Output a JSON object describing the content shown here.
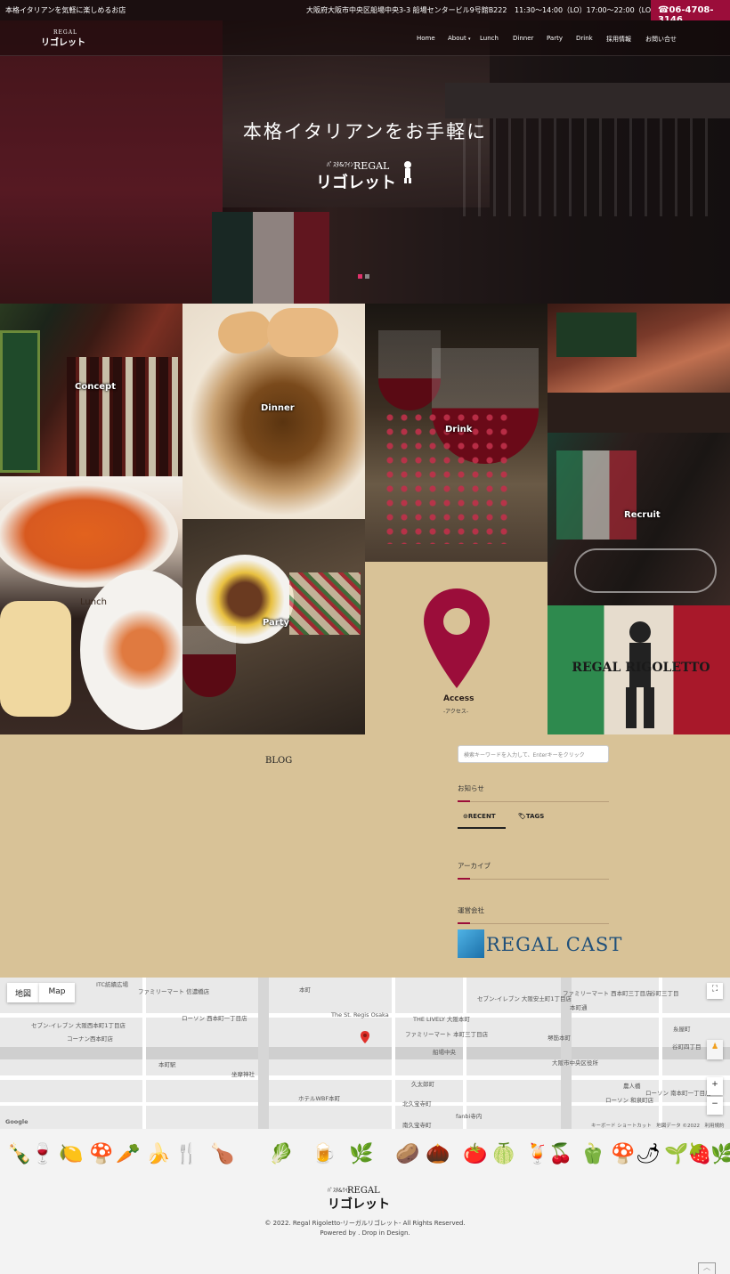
{
  "topbar": {
    "tagline": "本格イタリアンを気軽に楽しめるお店",
    "address": "大阪府大阪市中央区船場中央3-3 船場センタービル9号館B222",
    "hours": "11:30～14:00（LO）17:00～22:00（LO）",
    "phone": "06-4708-3146",
    "phone_icon": "phone-icon"
  },
  "logo": {
    "small_caption": "REGAL",
    "name": "リゴレット",
    "tag": "ﾊﾟｽﾀ&ﾜｲﾝ"
  },
  "nav": {
    "items": [
      {
        "label": "Home"
      },
      {
        "label": "About"
      },
      {
        "label": "Lunch"
      },
      {
        "label": "Dinner"
      },
      {
        "label": "Party"
      },
      {
        "label": "Drink"
      },
      {
        "label": "採用情報"
      },
      {
        "label": "お問い合せ"
      }
    ],
    "dropdown_icon": "chevron-down-icon"
  },
  "hero": {
    "title": "本格イタリアンをお手軽に",
    "slides": 2,
    "active_slide": 1
  },
  "tiles": {
    "concept": "Concept",
    "dinner": "Dinner",
    "drink": "Drink",
    "recruit": "Recruit",
    "lunch": "Lunch",
    "party": "Party",
    "access": "Access",
    "access_sub": "-アクセス-",
    "brand": "REGAL RIGOLETTO"
  },
  "blog": {
    "heading": "BLOG"
  },
  "sidebar": {
    "search_placeholder": "検索キーワードを入力して、Enterキーをクリック",
    "news_heading": "お知らせ",
    "tab_recent": "RECENT",
    "tab_tags": "TAGS",
    "archive_heading": "アーカイブ",
    "company_heading": "運営会社",
    "company_logo_text": "REGAL CAST"
  },
  "map": {
    "type_map": "地図",
    "type_satellite": "Map",
    "labels": [
      "ファミリーマート 信濃橋店",
      "本町",
      "ローソン 西本町一丁目店",
      "セブン-イレブン 大阪西本町1丁目店",
      "コーナン西本町店",
      "The St. Regis Osaka",
      "THE LIVELY 大阪本町",
      "セブン-イレブン 大阪安土町1丁目店",
      "ファミリーマート 西本町三丁目店",
      "本町通",
      "船場中央",
      "久太郎町",
      "北久宝寺町",
      "南久宝寺町",
      "坐摩神社",
      "ホテルWBF本町",
      "ローソン 和泉町店",
      "農人橋",
      "谷町四丁目",
      "ファミリーマート 本町三丁目店",
      "ローソン 南本町一丁目店",
      "大阪市中央区役所",
      "fanbi寺内",
      "糸屋町",
      "谷町三丁目",
      "ITC紡績広場",
      "本町駅",
      "堺筋本町"
    ],
    "attribution": "キーボード ショートカット　地図データ ©2022　利用規約",
    "google_text": "Google"
  },
  "footer": {
    "copyright": "© 2022. Regal Rigoletto-リーガルリゴレット- All Rights Reserved.",
    "powered": "Powered by . Drop in Design."
  },
  "colors": {
    "accent": "#9b0d3a",
    "sand": "#d8c297"
  }
}
